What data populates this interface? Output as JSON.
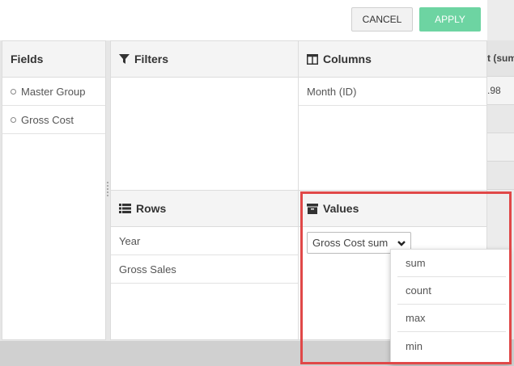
{
  "toolbar": {
    "cancel_label": "CANCEL",
    "apply_label": "APPLY"
  },
  "fields_panel": {
    "title": "Fields",
    "items": [
      "Master Group",
      "Gross Cost"
    ]
  },
  "filters_panel": {
    "title": "Filters"
  },
  "columns_panel": {
    "title": "Columns",
    "items": [
      "Month (ID)"
    ]
  },
  "rows_panel": {
    "title": "Rows",
    "items": [
      "Year",
      "Gross Sales"
    ]
  },
  "values_panel": {
    "title": "Values",
    "selected": "Gross Cost sum"
  },
  "aggregation_menu": {
    "options": [
      "sum",
      "count",
      "max",
      "min"
    ]
  },
  "background_table": {
    "header_fragment": "t (sum",
    "value_fragment": ".98"
  },
  "colors": {
    "apply": "#6dd4a2",
    "highlight": "#e04848"
  }
}
